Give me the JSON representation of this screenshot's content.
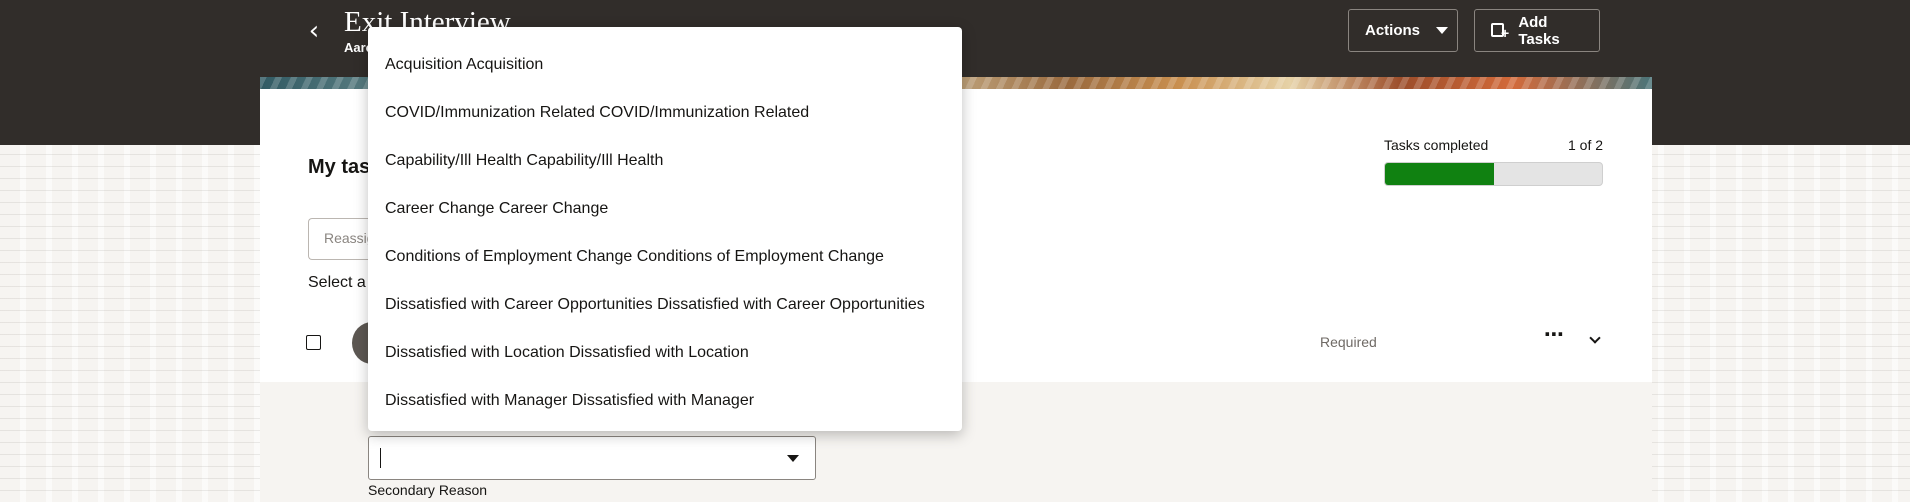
{
  "header": {
    "back_icon": "chevron-left-icon",
    "title": "Exit Interview",
    "subtitle": "Aaro",
    "actions_label": "Actions",
    "add_tasks_label": "Add Tasks"
  },
  "tasks": {
    "section_title": "My tas",
    "progress_label": "Tasks completed",
    "progress_count": "1 of 2",
    "progress_fraction": 0.5,
    "reassign_placeholder": "Reassign",
    "select_hint": "Select a",
    "row_status": "Required"
  },
  "form": {
    "field_label": "Secondary Reason"
  },
  "dropdown": {
    "options": [
      "Acquisition Acquisition",
      "COVID/Immunization Related COVID/Immunization Related",
      "Capability/Ill Health Capability/Ill Health",
      "Career Change Career Change",
      "Conditions of Employment Change Conditions of Employment Change",
      "Dissatisfied with Career Opportunities Dissatisfied with Career Opportunities",
      "Dissatisfied with Location Dissatisfied with Location",
      "Dissatisfied with Manager Dissatisfied with Manager"
    ]
  },
  "colors": {
    "header_bg": "#312d2a",
    "progress_fill": "#108111"
  }
}
